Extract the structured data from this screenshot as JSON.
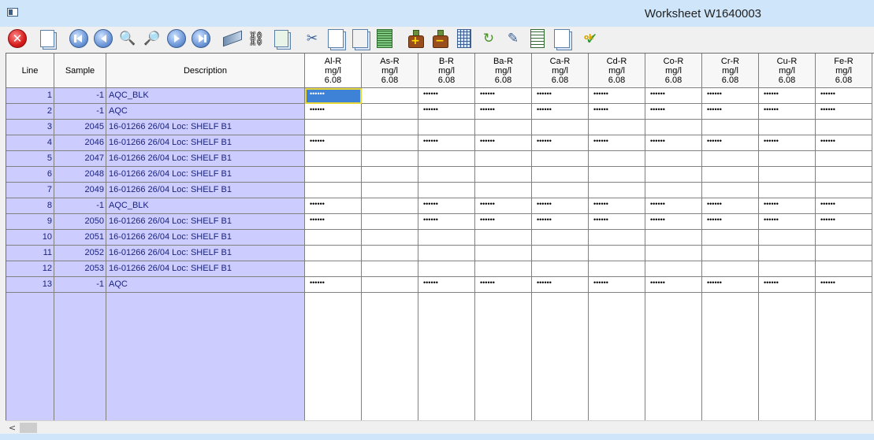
{
  "window": {
    "title": "Worksheet W1640003"
  },
  "toolbar": {
    "icons": [
      "close-icon",
      "worksheet-icon",
      "first-record-icon",
      "previous-record-icon",
      "zoom-in-icon",
      "zoom-out-icon",
      "next-record-icon",
      "last-record-icon",
      "ruler-icon",
      "binoculars-icon",
      "sample-icon",
      "cut-icon",
      "copy-icon",
      "paste-icon",
      "list-icon",
      "add-flask-icon",
      "remove-flask-icon",
      "calculator-icon",
      "refresh-icon",
      "edit-icon",
      "export-icon",
      "document-icon",
      "ok-check-icon"
    ],
    "ok_label": "ok"
  },
  "columns": {
    "line": "Line",
    "sample": "Sample",
    "description": "Description",
    "analytes": [
      {
        "name": "Al-R",
        "unit": "mg/l",
        "version": "6.08"
      },
      {
        "name": "As-R",
        "unit": "mg/l",
        "version": "6.08"
      },
      {
        "name": "B-R",
        "unit": "mg/l",
        "version": "6.08"
      },
      {
        "name": "Ba-R",
        "unit": "mg/l",
        "version": "6.08"
      },
      {
        "name": "Ca-R",
        "unit": "mg/l",
        "version": "6.08"
      },
      {
        "name": "Cd-R",
        "unit": "mg/l",
        "version": "6.08"
      },
      {
        "name": "Co-R",
        "unit": "mg/l",
        "version": "6.08"
      },
      {
        "name": "Cr-R",
        "unit": "mg/l",
        "version": "6.08"
      },
      {
        "name": "Cu-R",
        "unit": "mg/l",
        "version": "6.08"
      },
      {
        "name": "Fe-R",
        "unit": "mg/l",
        "version": "6.08"
      }
    ]
  },
  "rows": [
    {
      "line": "1",
      "sample": "-1",
      "description": "AQC_BLK",
      "results": [
        "••••••",
        "",
        "••••••",
        "••••••",
        "••••••",
        "••••••",
        "••••••",
        "••••••",
        "••••••",
        "••••••"
      ]
    },
    {
      "line": "2",
      "sample": "-1",
      "description": "AQC",
      "results": [
        "••••••",
        "",
        "••••••",
        "••••••",
        "••••••",
        "••••••",
        "••••••",
        "••••••",
        "••••••",
        "••••••"
      ]
    },
    {
      "line": "3",
      "sample": "2045",
      "description": "16-01266 26/04 Loc: SHELF B1",
      "results": [
        "",
        "",
        "",
        "",
        "",
        "",
        "",
        "",
        "",
        ""
      ]
    },
    {
      "line": "4",
      "sample": "2046",
      "description": "16-01266 26/04 Loc: SHELF B1",
      "results": [
        "••••••",
        "",
        "••••••",
        "••••••",
        "••••••",
        "••••••",
        "••••••",
        "••••••",
        "••••••",
        "••••••"
      ]
    },
    {
      "line": "5",
      "sample": "2047",
      "description": "16-01266 26/04 Loc: SHELF B1",
      "results": [
        "",
        "",
        "",
        "",
        "",
        "",
        "",
        "",
        "",
        ""
      ]
    },
    {
      "line": "6",
      "sample": "2048",
      "description": "16-01266 26/04 Loc: SHELF B1",
      "results": [
        "",
        "",
        "",
        "",
        "",
        "",
        "",
        "",
        "",
        ""
      ]
    },
    {
      "line": "7",
      "sample": "2049",
      "description": "16-01266 26/04 Loc: SHELF B1",
      "results": [
        "",
        "",
        "",
        "",
        "",
        "",
        "",
        "",
        "",
        ""
      ]
    },
    {
      "line": "8",
      "sample": "-1",
      "description": "AQC_BLK",
      "results": [
        "••••••",
        "",
        "••••••",
        "••••••",
        "••••••",
        "••••••",
        "••••••",
        "••••••",
        "••••••",
        "••••••"
      ]
    },
    {
      "line": "9",
      "sample": "2050",
      "description": "16-01266 26/04 Loc: SHELF B1",
      "results": [
        "••••••",
        "",
        "••••••",
        "••••••",
        "••••••",
        "••••••",
        "••••••",
        "••••••",
        "••••••",
        "••••••"
      ]
    },
    {
      "line": "10",
      "sample": "2051",
      "description": "16-01266 26/04 Loc: SHELF B1",
      "results": [
        "",
        "",
        "",
        "",
        "",
        "",
        "",
        "",
        "",
        ""
      ]
    },
    {
      "line": "11",
      "sample": "2052",
      "description": "16-01266 26/04 Loc: SHELF B1",
      "results": [
        "",
        "",
        "",
        "",
        "",
        "",
        "",
        "",
        "",
        ""
      ]
    },
    {
      "line": "12",
      "sample": "2053",
      "description": "16-01266 26/04 Loc: SHELF B1",
      "results": [
        "",
        "",
        "",
        "",
        "",
        "",
        "",
        "",
        "",
        ""
      ]
    },
    {
      "line": "13",
      "sample": "-1",
      "description": "AQC",
      "results": [
        "••••••",
        "",
        "••••••",
        "••••••",
        "••••••",
        "••••••",
        "••••••",
        "••••••",
        "••••••",
        "••••••"
      ]
    }
  ],
  "colors": {
    "key_column_bg": "#ccccff",
    "selected_cell_bg": "#3e82d8",
    "selected_cell_border": "#e6d83a",
    "title_bar": "#cfe5fa"
  },
  "scrollbar": {
    "left_arrow": "<"
  }
}
